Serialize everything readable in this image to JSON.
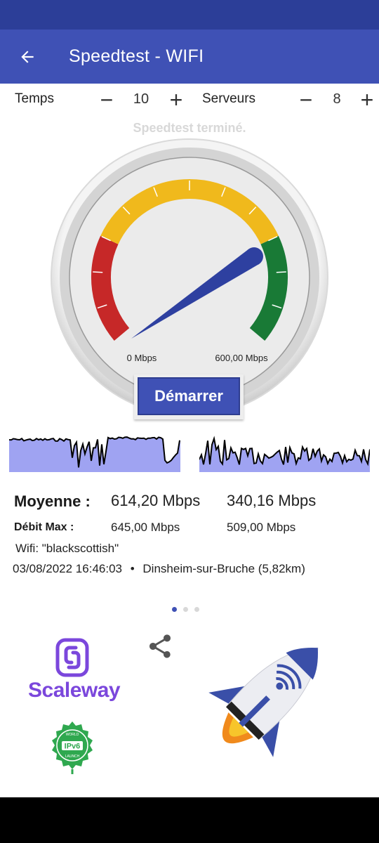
{
  "app": {
    "title": "Speedtest - WIFI"
  },
  "controls": {
    "time_label": "Temps",
    "time_value": "10",
    "servers_label": "Serveurs",
    "servers_value": "8",
    "minus": "−",
    "plus": "+"
  },
  "status_message": "Speedtest terminé.",
  "gauge": {
    "min_label": "0 Mbps",
    "max_label": "600,00 Mbps",
    "needle_value": 614.2,
    "max_value": 600
  },
  "start_button": "Démarrer",
  "results": {
    "average_label": "Moyenne :",
    "average_download": "614,20 Mbps",
    "average_upload": "340,16 Mbps",
    "max_label": "Débit Max :",
    "max_download": "645,00 Mbps",
    "max_upload": "509,00 Mbps",
    "wifi": "Wifi: \"blackscottish\"",
    "date": "03/08/2022 16:46:03",
    "separator": "•",
    "server": "Dinsheim-sur-Bruche (5,82km)"
  },
  "pager": {
    "pages": 3,
    "active": 0
  },
  "sponsor": {
    "name": "Scaleway",
    "ipv6_badge": "IPv6",
    "ipv6_small_top": "WORLD",
    "ipv6_small_bottom": "LAUNCH"
  },
  "icons": {
    "back": "arrow-left-icon",
    "share": "share-icon",
    "rocket": "rocket-icon"
  },
  "colors": {
    "app_bar": "#3f51b5",
    "status_bar": "#2c3e98",
    "gauge_red": "#c62828",
    "gauge_yellow": "#f0b91c",
    "gauge_green": "#197a36",
    "needle": "#2e40a0",
    "graph_fill": "#9fa3f2",
    "scaleway": "#7b47dc",
    "ipv6": "#2fa84f"
  }
}
